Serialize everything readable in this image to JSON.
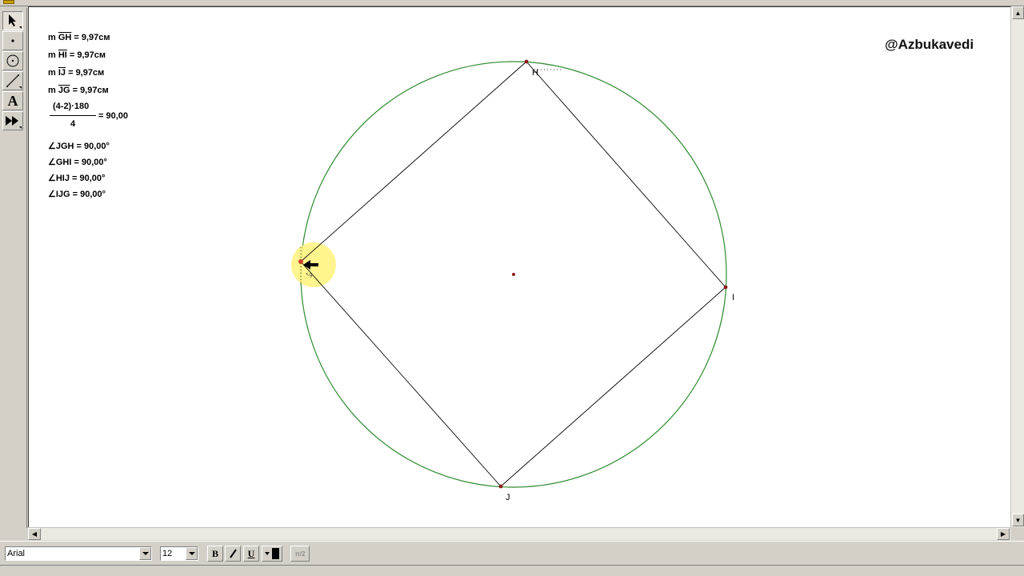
{
  "canvas": {
    "watermark": "@Azbukavedi",
    "measurements": [
      {
        "prefix": "m ",
        "segment": "GH",
        "value": " = 9,97см"
      },
      {
        "prefix": "m ",
        "segment": "HI",
        "value": " = 9,97см"
      },
      {
        "prefix": "m ",
        "segment": "IJ",
        "value": " = 9,97см"
      },
      {
        "prefix": "m ",
        "segment": "JG",
        "value": " = 9,97см"
      }
    ],
    "calculation": {
      "numerator": "(4-2)·180",
      "denominator": "4",
      "result": "= 90,00"
    },
    "angles": [
      {
        "label": "∠JGH = 90,00°"
      },
      {
        "label": "∠GHI = 90,00°"
      },
      {
        "label": "∠HIJ = 90,00°"
      },
      {
        "label": "∠IJG = 90,00°"
      }
    ],
    "points": {
      "H": "H",
      "I": "I",
      "J": "J"
    },
    "colors": {
      "circle": "#2e8b2e",
      "point": "#8b1a1a",
      "cursor_highlight": "#fff27a",
      "segment": "#000000"
    }
  },
  "toolbox": {
    "tools": [
      {
        "name": "selection-arrow-icon",
        "pressed": true
      },
      {
        "name": "point-tool-icon",
        "pressed": false
      },
      {
        "name": "compass-tool-icon",
        "pressed": false
      },
      {
        "name": "straightedge-tool-icon",
        "pressed": false
      },
      {
        "name": "text-tool-icon",
        "glyph": "A",
        "pressed": false
      },
      {
        "name": "custom-tool-icon",
        "pressed": false
      }
    ]
  },
  "textbar": {
    "font": "Arial",
    "size": "12",
    "bold_label": "B",
    "italic_label": "I",
    "underline_label": "U",
    "symbol_label": "π/2"
  }
}
